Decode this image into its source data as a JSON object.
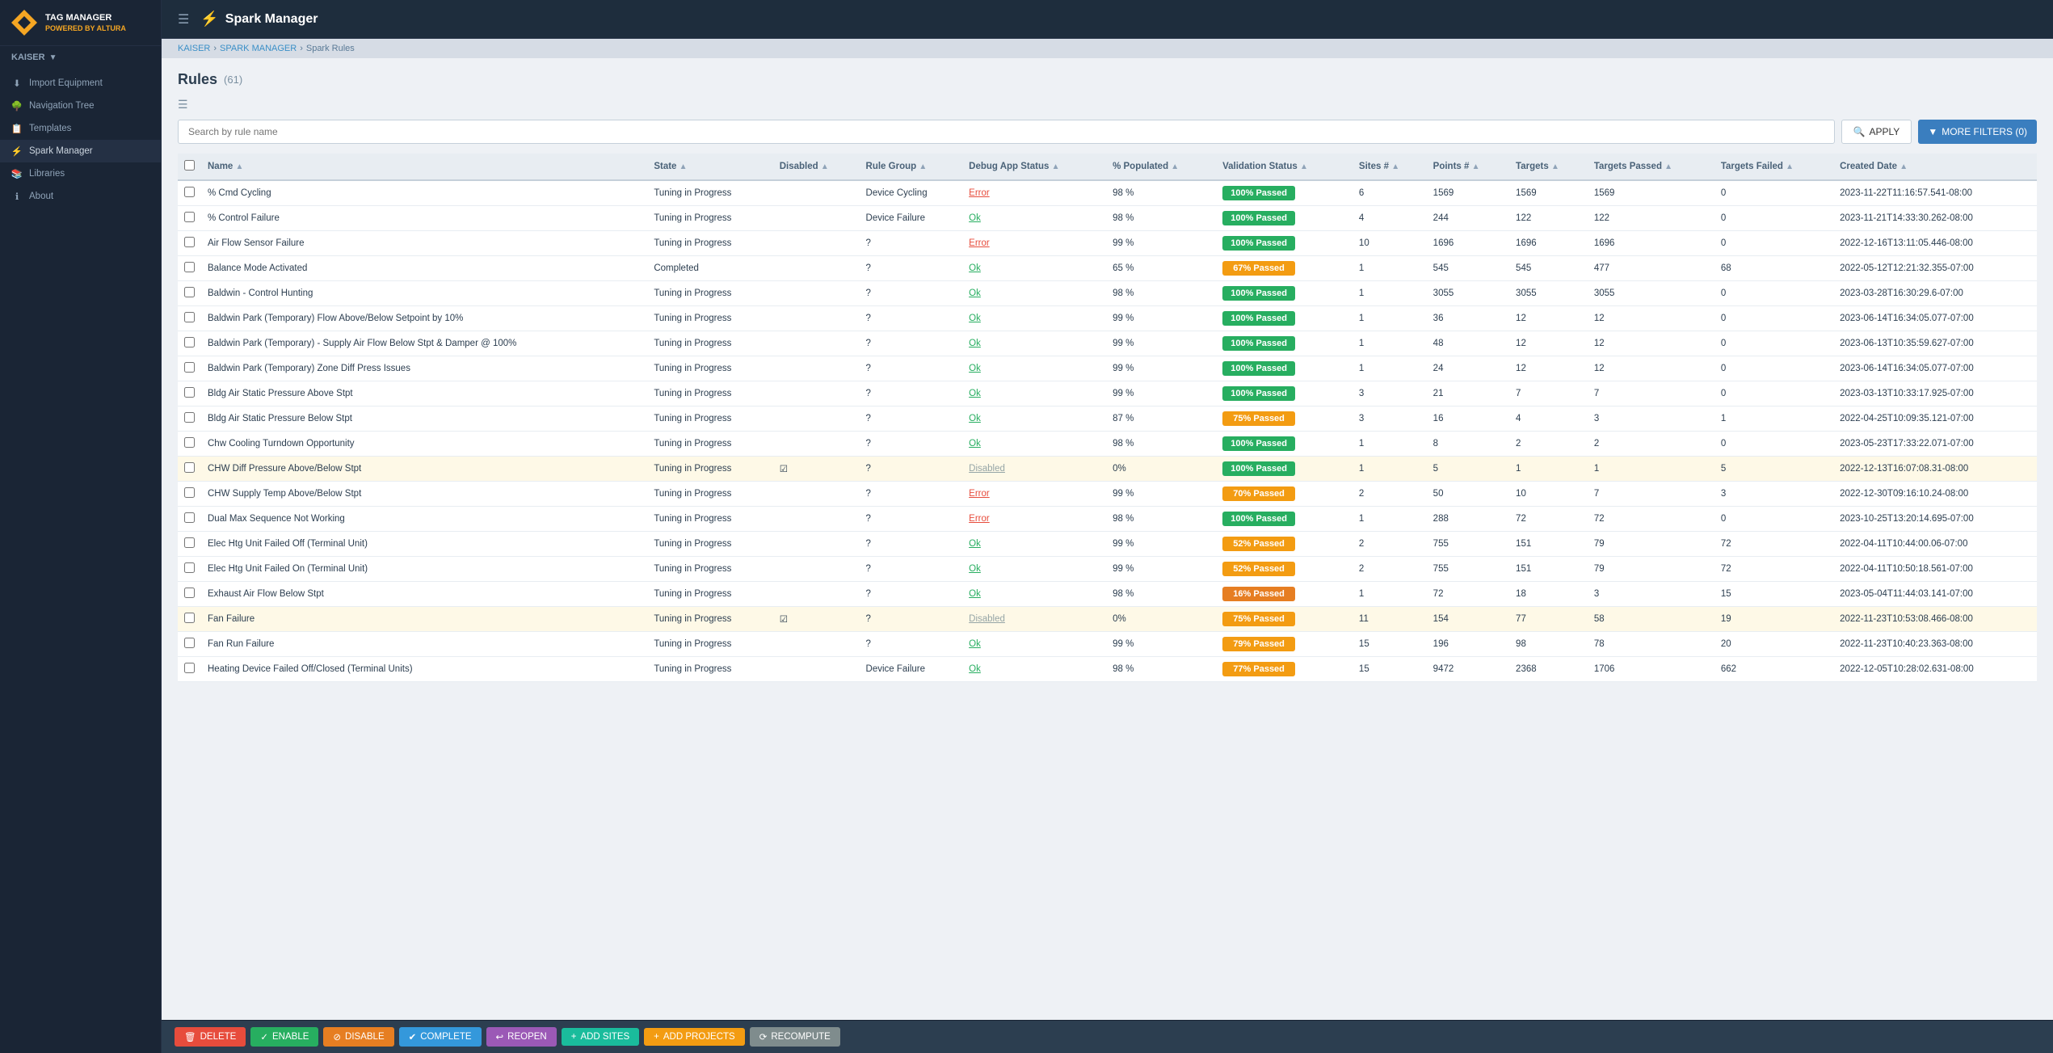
{
  "sidebar": {
    "logo_text": "TAG MANAGER",
    "logo_sub": "POWERED BY ALTURA",
    "user": "KAISER",
    "items": [
      {
        "id": "import-equipment",
        "label": "Import Equipment",
        "icon": "⬇"
      },
      {
        "id": "navigation-tree",
        "label": "Navigation Tree",
        "icon": "🌳"
      },
      {
        "id": "templates",
        "label": "Templates",
        "icon": "📋"
      },
      {
        "id": "spark-manager",
        "label": "Spark Manager",
        "icon": "⚡",
        "active": true
      },
      {
        "id": "libraries",
        "label": "Libraries",
        "icon": "📚"
      },
      {
        "id": "about",
        "label": "About",
        "icon": "ℹ"
      }
    ]
  },
  "topbar": {
    "title": "Spark Manager",
    "icon": "⚡"
  },
  "breadcrumb": {
    "items": [
      "KAISER",
      "SPARK MANAGER",
      "Spark Rules"
    ]
  },
  "page": {
    "title": "Rules",
    "count": "(61)"
  },
  "search": {
    "placeholder": "Search by rule name"
  },
  "buttons": {
    "apply": "APPLY",
    "more_filters": "MORE FILTERS (0)",
    "delete": "DELETE",
    "enable": "ENABLE",
    "disable": "DISABLE",
    "complete": "COMPLETE",
    "reopen": "REOPEN",
    "add_sites": "ADD SITES",
    "add_projects": "ADD PROJECTS",
    "recompute": "RECOMPUTE"
  },
  "table": {
    "columns": [
      "Name",
      "State",
      "Disabled",
      "Rule Group",
      "Debug App Status",
      "% Populated",
      "Validation Status",
      "Sites #",
      "Points #",
      "Targets",
      "Targets Passed",
      "Targets Failed",
      "Created Date"
    ],
    "rows": [
      {
        "name": "% Cmd Cycling",
        "state": "Tuning in Progress",
        "disabled": "",
        "rule_group": "Device Cycling",
        "debug": "Error",
        "debug_type": "error",
        "populated": "98 %",
        "validation": "100% Passed",
        "val_type": "green",
        "sites": "6",
        "points": "1569",
        "targets": "1569",
        "targets_passed": "1569",
        "targets_failed": "0",
        "created": "2023-11-22T11:16:57.541-08:00",
        "highlighted": false
      },
      {
        "name": "% Control Failure",
        "state": "Tuning in Progress",
        "disabled": "",
        "rule_group": "Device Failure",
        "debug": "Ok",
        "debug_type": "ok",
        "populated": "98 %",
        "validation": "100% Passed",
        "val_type": "green",
        "sites": "4",
        "points": "244",
        "targets": "122",
        "targets_passed": "122",
        "targets_failed": "0",
        "created": "2023-11-21T14:33:30.262-08:00",
        "highlighted": false
      },
      {
        "name": "Air Flow Sensor Failure",
        "state": "Tuning in Progress",
        "disabled": "",
        "rule_group": "?",
        "debug": "Error",
        "debug_type": "error",
        "populated": "99 %",
        "validation": "100% Passed",
        "val_type": "green",
        "sites": "10",
        "points": "1696",
        "targets": "1696",
        "targets_passed": "1696",
        "targets_failed": "0",
        "created": "2022-12-16T13:11:05.446-08:00",
        "highlighted": false
      },
      {
        "name": "Balance Mode Activated",
        "state": "Completed",
        "disabled": "",
        "rule_group": "?",
        "debug": "Ok",
        "debug_type": "ok",
        "populated": "65 %",
        "validation": "67% Passed",
        "val_type": "yellow",
        "sites": "1",
        "points": "545",
        "targets": "545",
        "targets_passed": "477",
        "targets_failed": "68",
        "created": "2022-05-12T12:21:32.355-07:00",
        "highlighted": false
      },
      {
        "name": "Baldwin - Control Hunting",
        "state": "Tuning in Progress",
        "disabled": "",
        "rule_group": "?",
        "debug": "Ok",
        "debug_type": "ok",
        "populated": "98 %",
        "validation": "100% Passed",
        "val_type": "green",
        "sites": "1",
        "points": "3055",
        "targets": "3055",
        "targets_passed": "3055",
        "targets_failed": "0",
        "created": "2023-03-28T16:30:29.6-07:00",
        "highlighted": false
      },
      {
        "name": "Baldwin Park (Temporary) Flow Above/Below Setpoint by 10%",
        "state": "Tuning in Progress",
        "disabled": "",
        "rule_group": "?",
        "debug": "Ok",
        "debug_type": "ok",
        "populated": "99 %",
        "validation": "100% Passed",
        "val_type": "green",
        "sites": "1",
        "points": "36",
        "targets": "12",
        "targets_passed": "12",
        "targets_failed": "0",
        "created": "2023-06-14T16:34:05.077-07:00",
        "highlighted": false
      },
      {
        "name": "Baldwin Park (Temporary) - Supply Air Flow Below Stpt & Damper @ 100%",
        "state": "Tuning in Progress",
        "disabled": "",
        "rule_group": "?",
        "debug": "Ok",
        "debug_type": "ok",
        "populated": "99 %",
        "validation": "100% Passed",
        "val_type": "green",
        "sites": "1",
        "points": "48",
        "targets": "12",
        "targets_passed": "12",
        "targets_failed": "0",
        "created": "2023-06-13T10:35:59.627-07:00",
        "highlighted": false
      },
      {
        "name": "Baldwin Park (Temporary) Zone Diff Press Issues",
        "state": "Tuning in Progress",
        "disabled": "",
        "rule_group": "?",
        "debug": "Ok",
        "debug_type": "ok",
        "populated": "99 %",
        "validation": "100% Passed",
        "val_type": "green",
        "sites": "1",
        "points": "24",
        "targets": "12",
        "targets_passed": "12",
        "targets_failed": "0",
        "created": "2023-06-14T16:34:05.077-07:00",
        "highlighted": false
      },
      {
        "name": "Bldg Air Static Pressure Above Stpt",
        "state": "Tuning in Progress",
        "disabled": "",
        "rule_group": "?",
        "debug": "Ok",
        "debug_type": "ok",
        "populated": "99 %",
        "validation": "100% Passed",
        "val_type": "green",
        "sites": "3",
        "points": "21",
        "targets": "7",
        "targets_passed": "7",
        "targets_failed": "0",
        "created": "2023-03-13T10:33:17.925-07:00",
        "highlighted": false
      },
      {
        "name": "Bldg Air Static Pressure Below Stpt",
        "state": "Tuning in Progress",
        "disabled": "",
        "rule_group": "?",
        "debug": "Ok",
        "debug_type": "ok",
        "populated": "87 %",
        "validation": "75% Passed",
        "val_type": "yellow",
        "sites": "3",
        "points": "16",
        "targets": "4",
        "targets_passed": "3",
        "targets_failed": "1",
        "created": "2022-04-25T10:09:35.121-07:00",
        "highlighted": false
      },
      {
        "name": "Chw Cooling Turndown Opportunity",
        "state": "Tuning in Progress",
        "disabled": "",
        "rule_group": "?",
        "debug": "Ok",
        "debug_type": "ok",
        "populated": "98 %",
        "validation": "100% Passed",
        "val_type": "green",
        "sites": "1",
        "points": "8",
        "targets": "2",
        "targets_passed": "2",
        "targets_failed": "0",
        "created": "2023-05-23T17:33:22.071-07:00",
        "highlighted": false
      },
      {
        "name": "CHW Diff Pressure Above/Below Stpt",
        "state": "Tuning in Progress",
        "disabled": "☑",
        "rule_group": "?",
        "debug": "Disabled",
        "debug_type": "disabled",
        "populated": "0%",
        "validation": "100% Passed",
        "val_type": "green",
        "sites": "1",
        "points": "5",
        "targets": "1",
        "targets_passed": "1",
        "targets_failed": "5",
        "created": "2022-12-13T16:07:08.31-08:00",
        "highlighted": true
      },
      {
        "name": "CHW Supply Temp Above/Below Stpt",
        "state": "Tuning in Progress",
        "disabled": "",
        "rule_group": "?",
        "debug": "Error",
        "debug_type": "error",
        "populated": "99 %",
        "validation": "70% Passed",
        "val_type": "yellow",
        "sites": "2",
        "points": "50",
        "targets": "10",
        "targets_passed": "7",
        "targets_failed": "3",
        "created": "2022-12-30T09:16:10.24-08:00",
        "highlighted": false
      },
      {
        "name": "Dual Max Sequence Not Working",
        "state": "Tuning in Progress",
        "disabled": "",
        "rule_group": "?",
        "debug": "Error",
        "debug_type": "error",
        "populated": "98 %",
        "validation": "100% Passed",
        "val_type": "green",
        "sites": "1",
        "points": "288",
        "targets": "72",
        "targets_passed": "72",
        "targets_failed": "0",
        "created": "2023-10-25T13:20:14.695-07:00",
        "highlighted": false
      },
      {
        "name": "Elec Htg Unit Failed Off (Terminal Unit)",
        "state": "Tuning in Progress",
        "disabled": "",
        "rule_group": "?",
        "debug": "Ok",
        "debug_type": "ok",
        "populated": "99 %",
        "validation": "52% Passed",
        "val_type": "yellow",
        "sites": "2",
        "points": "755",
        "targets": "151",
        "targets_passed": "79",
        "targets_failed": "72",
        "created": "2022-04-11T10:44:00.06-07:00",
        "highlighted": false
      },
      {
        "name": "Elec Htg Unit Failed On (Terminal Unit)",
        "state": "Tuning in Progress",
        "disabled": "",
        "rule_group": "?",
        "debug": "Ok",
        "debug_type": "ok",
        "populated": "99 %",
        "validation": "52% Passed",
        "val_type": "yellow",
        "sites": "2",
        "points": "755",
        "targets": "151",
        "targets_passed": "79",
        "targets_failed": "72",
        "created": "2022-04-11T10:50:18.561-07:00",
        "highlighted": false
      },
      {
        "name": "Exhaust Air Flow Below Stpt",
        "state": "Tuning in Progress",
        "disabled": "",
        "rule_group": "?",
        "debug": "Ok",
        "debug_type": "ok",
        "populated": "98 %",
        "validation": "16% Passed",
        "val_type": "orange",
        "sites": "1",
        "points": "72",
        "targets": "18",
        "targets_passed": "3",
        "targets_failed": "15",
        "created": "2023-05-04T11:44:03.141-07:00",
        "highlighted": false
      },
      {
        "name": "Fan Failure",
        "state": "Tuning in Progress",
        "disabled": "☑",
        "rule_group": "?",
        "debug": "Disabled",
        "debug_type": "disabled",
        "populated": "0%",
        "validation": "75% Passed",
        "val_type": "yellow",
        "sites": "11",
        "points": "154",
        "targets": "77",
        "targets_passed": "58",
        "targets_failed": "19",
        "created": "2022-11-23T10:53:08.466-08:00",
        "highlighted": true
      },
      {
        "name": "Fan Run Failure",
        "state": "Tuning in Progress",
        "disabled": "",
        "rule_group": "?",
        "debug": "Ok",
        "debug_type": "ok",
        "populated": "99 %",
        "validation": "79% Passed",
        "val_type": "yellow",
        "sites": "15",
        "points": "196",
        "targets": "98",
        "targets_passed": "78",
        "targets_failed": "20",
        "created": "2022-11-23T10:40:23.363-08:00",
        "highlighted": false
      },
      {
        "name": "Heating Device Failed Off/Closed (Terminal Units)",
        "state": "Tuning in Progress",
        "disabled": "",
        "rule_group": "Device Failure",
        "debug": "Ok",
        "debug_type": "ok",
        "populated": "98 %",
        "validation": "77% Passed",
        "val_type": "yellow",
        "sites": "15",
        "points": "9472",
        "targets": "2368",
        "targets_passed": "1706",
        "targets_failed": "662",
        "created": "2022-12-05T10:28:02.631-08:00",
        "highlighted": false
      }
    ]
  }
}
